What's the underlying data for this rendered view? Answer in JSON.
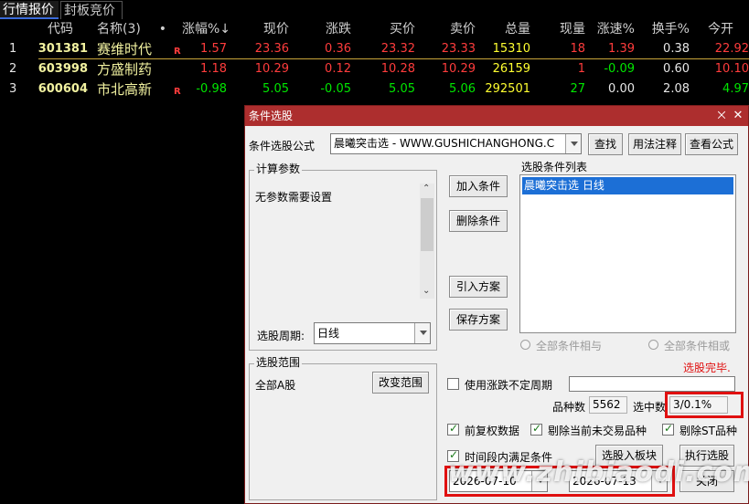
{
  "tabs": [
    {
      "label": "行情报价"
    },
    {
      "label": "封板竞价"
    }
  ],
  "table": {
    "headers": [
      "代码",
      "名称(3)",
      "•",
      "涨幅%↓",
      "现价",
      "涨跌",
      "买价",
      "卖价",
      "总量",
      "现量",
      "涨速%",
      "换手%",
      "今开"
    ],
    "rows": [
      {
        "idx": "1",
        "code": "301381",
        "name": "赛维时代",
        "flag": "R",
        "chg_pct": "1.57",
        "price": "23.36",
        "chg": "0.36",
        "bid": "23.32",
        "ask": "23.33",
        "vol": "15310",
        "cur": "18",
        "speed": "1.39",
        "turn": "0.38",
        "open": "22.92"
      },
      {
        "idx": "2",
        "code": "603998",
        "name": "方盛制药",
        "flag": "",
        "chg_pct": "1.18",
        "price": "10.29",
        "chg": "0.12",
        "bid": "10.28",
        "ask": "10.29",
        "vol": "26159",
        "cur": "1",
        "speed": "-0.09",
        "turn": "0.60",
        "open": "10.10"
      },
      {
        "idx": "3",
        "code": "600604",
        "name": "市北高新",
        "flag": "R",
        "chg_pct": "-0.98",
        "price": "5.05",
        "chg": "-0.05",
        "bid": "5.05",
        "ask": "5.06",
        "vol": "292501",
        "cur": "27",
        "speed": "0.00",
        "turn": "2.08",
        "open": "4.97"
      }
    ]
  },
  "dialog": {
    "title": "条件选股",
    "close_icon": "close-icon",
    "formula_label": "条件选股公式",
    "formula_value": "晨曦突击选 - WWW.GUSHICHANGHONG.C",
    "btn_find": "查找",
    "btn_usage": "用法注释",
    "btn_view": "查看公式",
    "params_title": "计算参数",
    "params_text": "无参数需要设置",
    "btn_add": "加入条件",
    "btn_delete": "删除条件",
    "btn_import": "引入方案",
    "btn_save": "保存方案",
    "cond_list_title": "选股条件列表",
    "cond_items": [
      "晨曦突击选  日线"
    ],
    "period_label": "选股周期:",
    "period_value": "日线",
    "radio_and": "全部条件相与",
    "radio_or": "全部条件相或",
    "status_text": "选股完毕.",
    "range_title": "选股范围",
    "range_value": "全部A股",
    "btn_change_range": "改变范围",
    "chk_irregular": "使用涨跌不定周期",
    "count_label": "品种数",
    "count_value": "5562",
    "selected_label": "选中数",
    "selected_value": "3/0.1%",
    "chk_adjust": "前复权数据",
    "chk_exclude_untraded": "剔除当前未交易品种",
    "chk_exclude_st": "剔除ST品种",
    "chk_time_range": "时间段内满足条件",
    "btn_to_block": "选股入板块",
    "btn_execute": "执行选股",
    "date_from": "2026-07-10",
    "date_to": "2026-07-13",
    "btn_close": "关闭"
  },
  "watermark": "www.zhibiaodi.com",
  "colors": {
    "up": "#ff3c3c",
    "down": "#00e600",
    "title_bar": "#ad2e2e",
    "highlight": "#e01010"
  }
}
